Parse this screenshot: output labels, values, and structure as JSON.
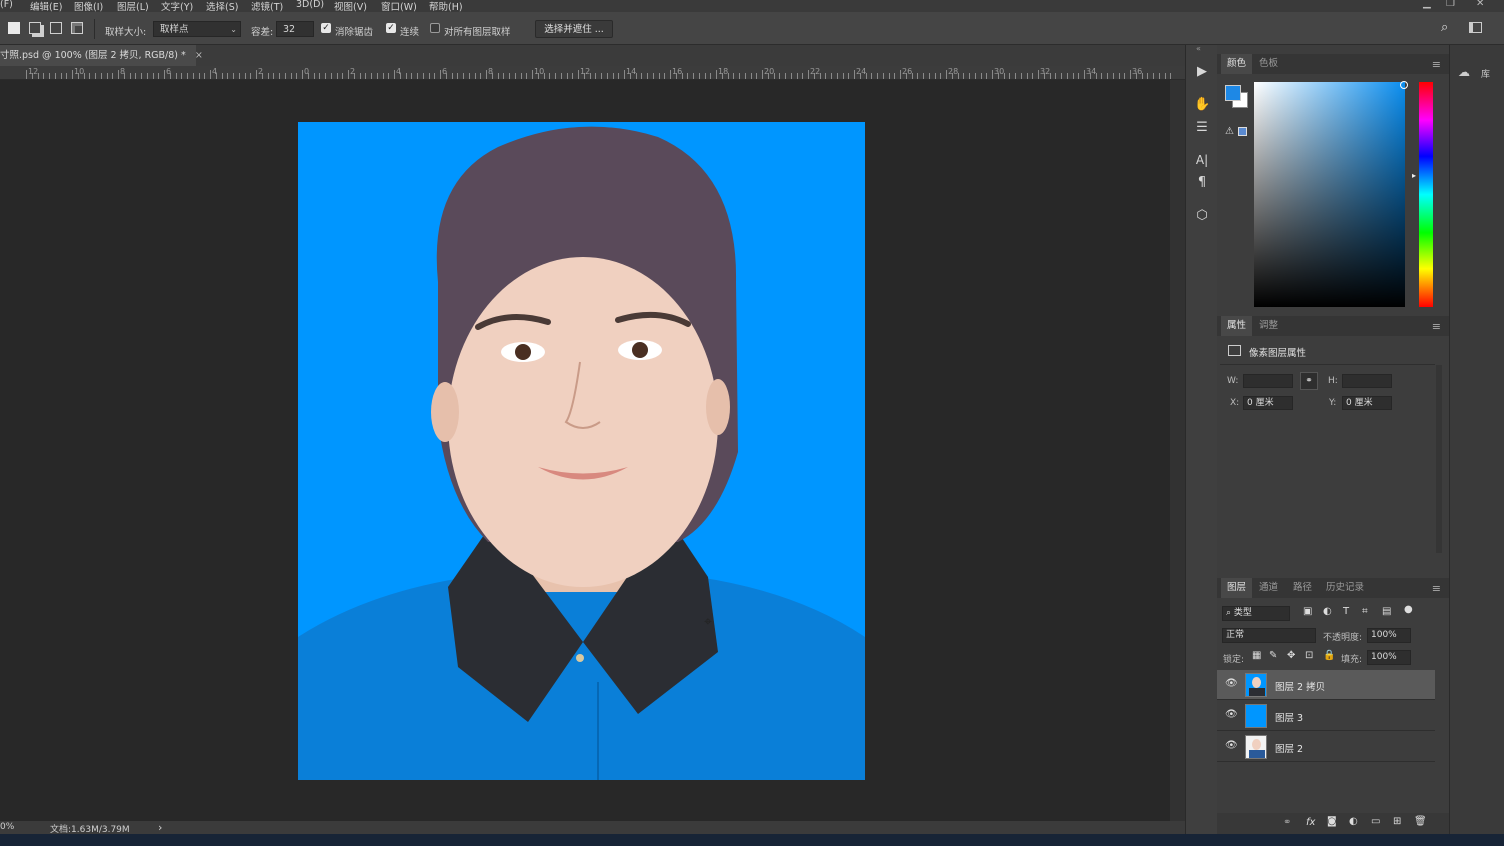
{
  "menu": [
    "(F)",
    "编辑(E)",
    "图像(I)",
    "图层(L)",
    "文字(Y)",
    "选择(S)",
    "滤镜(T)",
    "3D(D)",
    "视图(V)",
    "窗口(W)",
    "帮助(H)"
  ],
  "options": {
    "sample_size_label": "取样大小:",
    "sample_size_value": "取样点",
    "tolerance_label": "容差:",
    "tolerance_value": "32",
    "antialias_label": "消除锯齿",
    "contiguous_label": "连续",
    "all_layers_label": "对所有图层取样",
    "select_mask_button": "选择并遮住 ..."
  },
  "document": {
    "tab_title": "寸照.psd @ 100% (图层 2 拷贝, RGB/8) *",
    "close_glyph": "×"
  },
  "ruler_labels": [
    "12",
    "10",
    "8",
    "6",
    "4",
    "2",
    "0",
    "2",
    "4",
    "6",
    "8",
    "10",
    "12",
    "14",
    "16",
    "18",
    "20",
    "22",
    "24",
    "26",
    "28",
    "30",
    "32",
    "34",
    "36"
  ],
  "status": {
    "zoom": "0%",
    "doc_size": "文档:1.63M/3.79M",
    "arrow": "›"
  },
  "color_panel": {
    "tabs": [
      "颜色",
      "色板"
    ],
    "foreground": "#1e88e5",
    "background": "#ffffff"
  },
  "properties_panel": {
    "tabs": [
      "属性",
      "调整"
    ],
    "title": "像素图层属性",
    "w_label": "W:",
    "w_value": "",
    "h_label": "H:",
    "h_value": "",
    "x_label": "X:",
    "x_value": "0 厘米",
    "y_label": "Y:",
    "y_value": "0 厘米"
  },
  "layers_panel": {
    "tabs": [
      "图层",
      "通道",
      "路径",
      "历史记录"
    ],
    "filter_label": "类型",
    "blend_mode": "正常",
    "opacity_label": "不透明度:",
    "opacity_value": "100%",
    "lock_label": "锁定:",
    "fill_label": "填充:",
    "fill_value": "100%",
    "layers": [
      {
        "name": "图层 2 拷贝",
        "selected": true,
        "thumb": "portrait"
      },
      {
        "name": "图层 3",
        "selected": false,
        "thumb": "blue"
      },
      {
        "name": "图层 2",
        "selected": false,
        "thumb": "portrait"
      }
    ]
  },
  "library_label": "库",
  "colors": {
    "photo_background": "#0096ff",
    "shirt": "#0a7fd8",
    "collar": "#2b2d33"
  }
}
